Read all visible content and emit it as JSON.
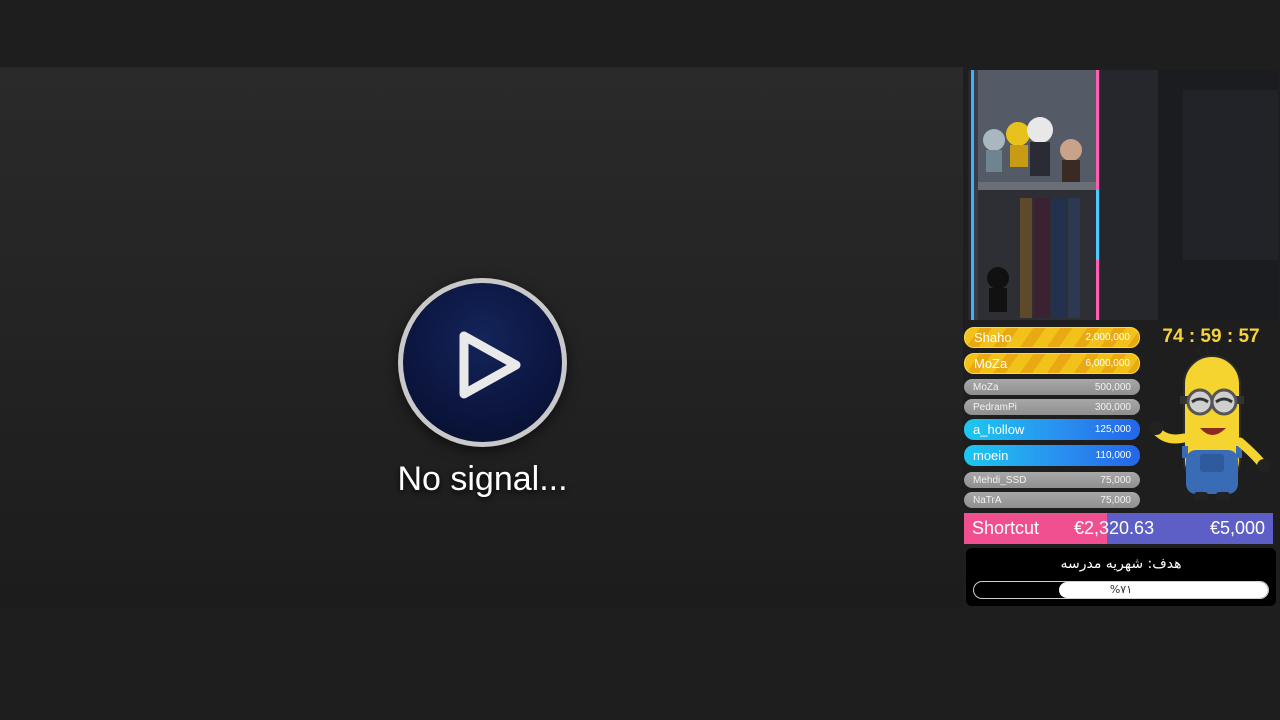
{
  "player": {
    "status_text": "No signal...",
    "play_icon": "play-icon"
  },
  "timer": "74 : 59 : 57",
  "donors": [
    {
      "name": "Shaho",
      "amount": "2,000,000",
      "style": "gold"
    },
    {
      "name": "MoZa",
      "amount": "6,000,000",
      "style": "gold"
    },
    {
      "name": "MoZa",
      "amount": "500,000",
      "style": "gray"
    },
    {
      "name": "PedramPi",
      "amount": "300,000",
      "style": "gray"
    },
    {
      "name": "a_hollow",
      "amount": "125,000",
      "style": "blue"
    },
    {
      "name": "moein",
      "amount": "110,000",
      "style": "blue"
    },
    {
      "name": "Mehdi_SSD",
      "amount": "75,000",
      "style": "gray"
    },
    {
      "name": "NaTrA",
      "amount": "75,000",
      "style": "gray"
    }
  ],
  "donation_goal": {
    "label": "Shortcut",
    "current": "€2,320.63",
    "target": "€5,000",
    "progress_fraction": 0.464
  },
  "school_goal": {
    "title": "هدف: شهریه مدرسه",
    "percent_text": "%۷۱",
    "progress_fraction": 0.71
  },
  "colors": {
    "goal_fill": "#f0508f",
    "goal_bg": "#5d5fc7",
    "timer": "#f7d23a",
    "gold_badge": "#f2c21a",
    "blue_badge": "#2a8ff0"
  }
}
